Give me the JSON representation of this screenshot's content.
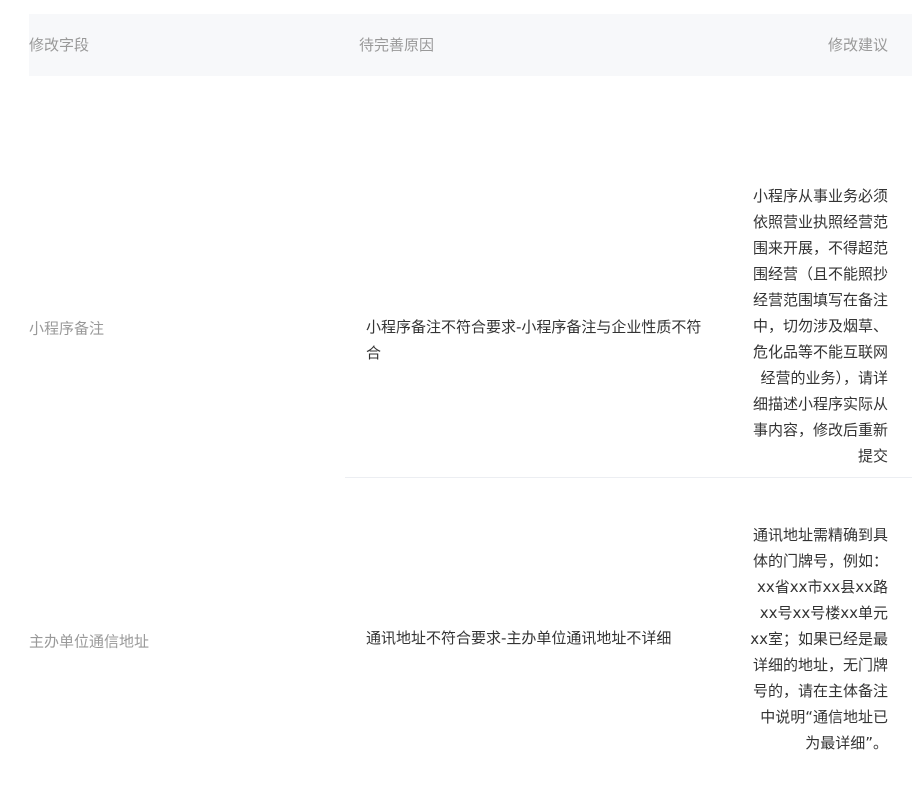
{
  "header": {
    "field": "修改字段",
    "reason": "待完善原因",
    "suggestion": "修改建议"
  },
  "rows": [
    {
      "field": "小程序备注",
      "reason": "小程序备注不符合要求-小程序备注与企业性质不符合",
      "suggestion": "小程序从事业务必须依照营业执照经营范围来开展，不得超范围经营（且不能照抄经营范围填写在备注中，切勿涉及烟草、危化品等不能互联网经营的业务），请详细描述小程序实际从事内容，修改后重新提交"
    },
    {
      "field": "主办单位通信地址",
      "reason": "通讯地址不符合要求-主办单位通讯地址不详细",
      "suggestion": "通讯地址需精确到具体的门牌号，例如：xx省xx市xx县xx路xx号xx号楼xx单元xx室；如果已经是最详细的地址，无门牌号的，请在主体备注中说明“通信地址已为最详细”。"
    }
  ]
}
